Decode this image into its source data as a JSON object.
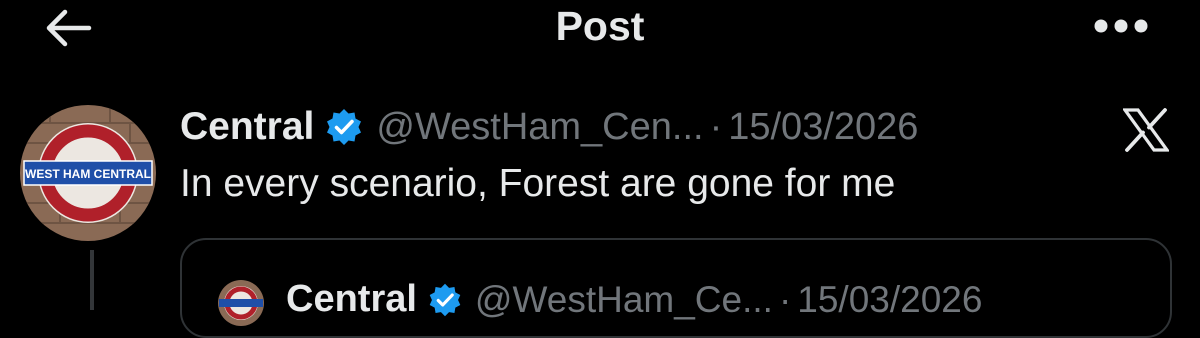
{
  "header": {
    "title": "Post",
    "back_icon": "arrow-left-icon",
    "more_icon": "more-horizontal-icon"
  },
  "post": {
    "avatar": {
      "icon": "roundel-avatar",
      "sign_text": "WEST HAM CENTRAL",
      "colors": {
        "ring": "#b0202a",
        "bar": "#1f4fa8",
        "brick": "#8a6a55"
      }
    },
    "display_name": "Central",
    "verified_icon": "verified-badge-icon",
    "handle": "@WestHam_Cen...",
    "separator": "·",
    "date": "15/03/2026",
    "platform_icon": "x-logo-icon",
    "text": "In every scenario, Forest are gone for me"
  },
  "quoted_post": {
    "display_name": "Central",
    "verified_icon": "verified-badge-icon",
    "handle": "@WestHam_Ce...",
    "separator": "·",
    "date": "15/03/2026"
  },
  "colors": {
    "background": "#000000",
    "text_primary": "#e7e9ea",
    "text_secondary": "#71767b",
    "verified": "#1d9bf0",
    "border": "#2f3336"
  }
}
